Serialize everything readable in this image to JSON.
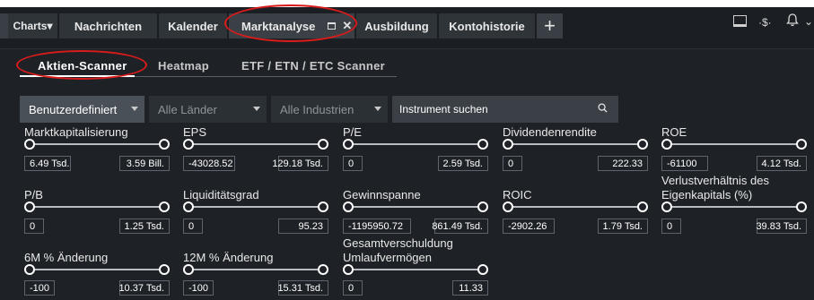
{
  "nav": {
    "tabs": [
      {
        "label": "Charts▾"
      },
      {
        "label": "Nachrichten"
      },
      {
        "label": "Kalender"
      },
      {
        "label": "Marktanalyse"
      },
      {
        "label": "Ausbildung"
      },
      {
        "label": "Kontohistorie"
      }
    ],
    "plus": "+",
    "close": "✕",
    "icons": [
      "layout-icon",
      "dollar-exchange-icon",
      "bell-icon",
      "chevron-down-icon"
    ],
    "dollar_glyph": "·$·",
    "bell_glyph": "🔔",
    "chevron_glyph": "⌄"
  },
  "subtabs": [
    {
      "label": "Aktien-Scanner"
    },
    {
      "label": "Heatmap"
    },
    {
      "label": "ETF / ETN / ETC Scanner"
    }
  ],
  "filters_bar": {
    "preset": "Benutzerdefiniert",
    "countries": "Alle Länder",
    "industries": "Alle Industrien",
    "search_placeholder": "Instrument suchen"
  },
  "filters": [
    {
      "label": "Marktkapitalisierung",
      "min": "6.49 Tsd.",
      "max": "3.59 Bill."
    },
    {
      "label": "EPS",
      "min": "-43028.52",
      "max": "129.18 Tsd."
    },
    {
      "label": "P/E",
      "min": "0",
      "max": "2.59 Tsd."
    },
    {
      "label": "Dividendenrendite",
      "min": "0",
      "max": "222.33"
    },
    {
      "label": "ROE",
      "min": "-61100",
      "max": "4.12 Tsd."
    },
    {
      "label": "P/B",
      "min": "0",
      "max": "1.25 Tsd."
    },
    {
      "label": "Liquiditätsgrad",
      "min": "0",
      "max": "95.23"
    },
    {
      "label": "Gewinnspanne",
      "min": "-1195950.72",
      "max": "861.49 Tsd."
    },
    {
      "label": "ROIC",
      "min": "-2902.26",
      "max": "1.79 Tsd."
    },
    {
      "label": "Verlustverhältnis des Eigenkapitals (%)",
      "label_line1": "Verlustverhältnis des",
      "label_line2": "Eigenkapitals (%)",
      "min": "0",
      "max": "39.83 Tsd."
    },
    {
      "label": "6M % Änderung",
      "min": "-100",
      "max": "10.37 Tsd."
    },
    {
      "label": "12M % Änderung",
      "min": "-100",
      "max": "15.31 Tsd."
    },
    {
      "label": "Gesamtverschuldung Umlaufvermögen",
      "label_line1": "Gesamtverschuldung",
      "label_line2": "Umlaufvermögen",
      "min": "0",
      "max": "11.33"
    }
  ]
}
